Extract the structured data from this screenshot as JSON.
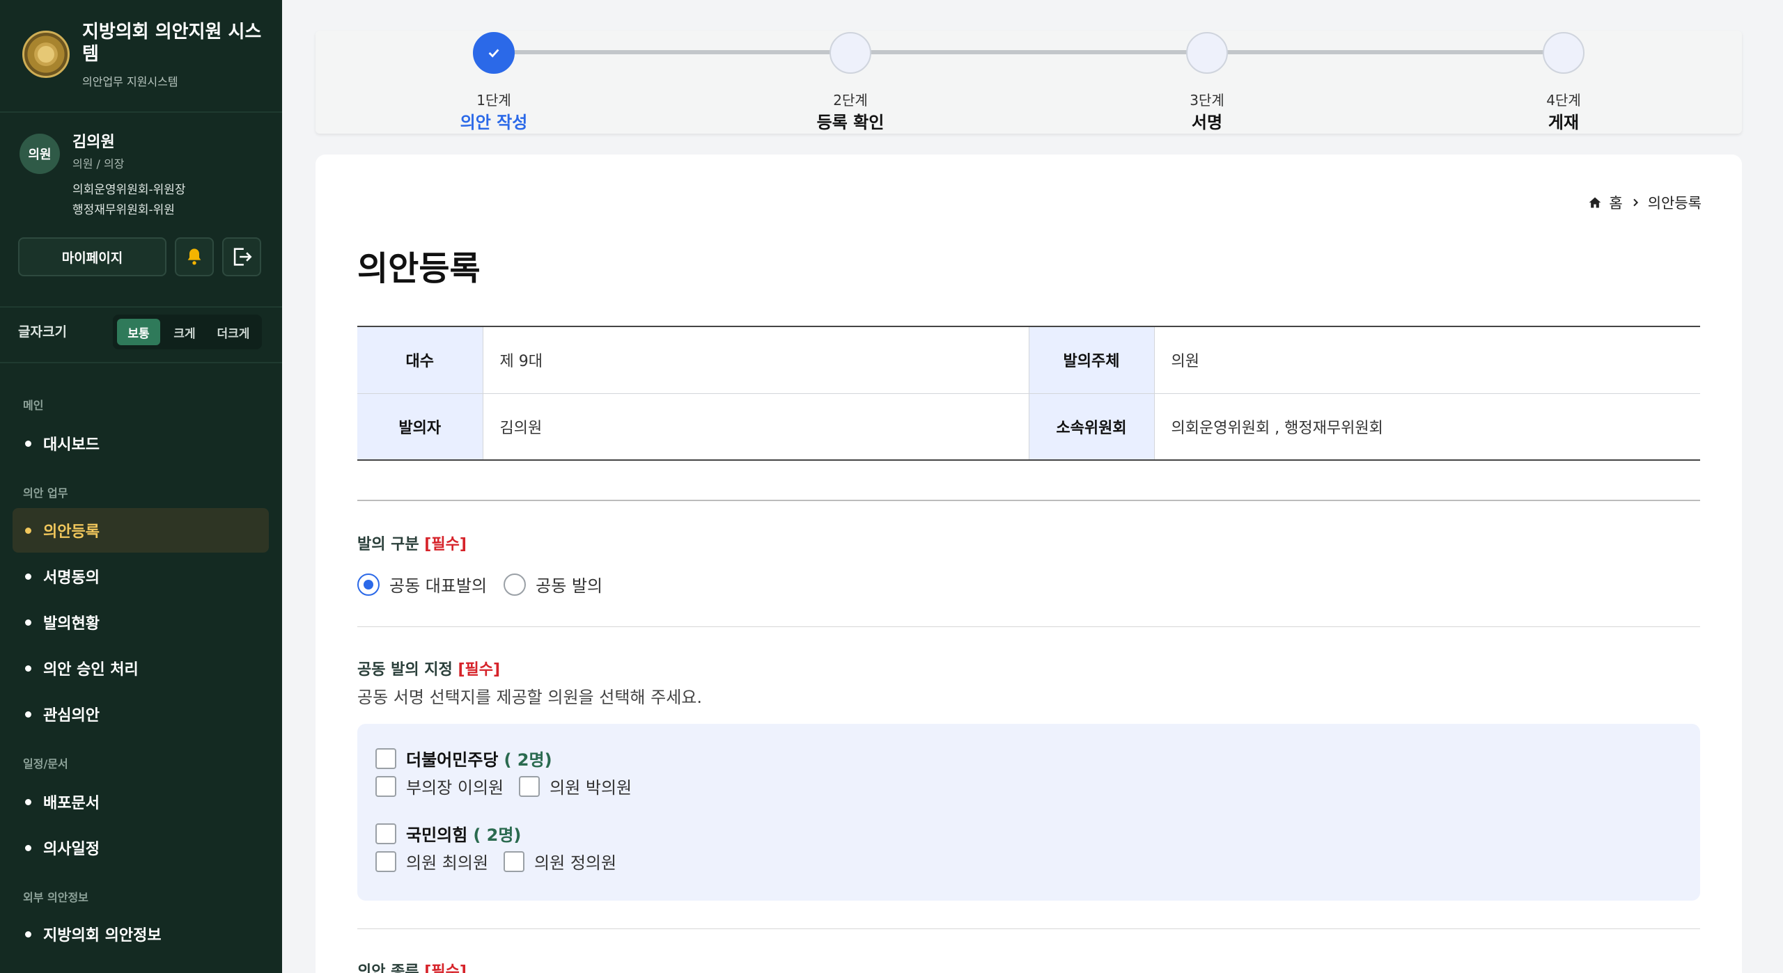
{
  "sidebar": {
    "brand": {
      "title": "지방의회 의안지원 시스템",
      "subtitle": "의안업무 지원시스템"
    },
    "profile": {
      "avatar": "의원",
      "name": "김의원",
      "role": "의원 / 의장",
      "committees": [
        "의회운영위원회-위원장",
        "행정재무위원회-위원"
      ]
    },
    "mypage": "마이페이지",
    "font_size": {
      "label": "글자크기",
      "options": [
        "보통",
        "크게",
        "더크게"
      ],
      "selected": "보통"
    },
    "sections": [
      {
        "title": "메인",
        "items": [
          "대시보드"
        ]
      },
      {
        "title": "의안 업무",
        "items": [
          "의안등록",
          "서명동의",
          "발의현황",
          "의안 승인 처리",
          "관심의안"
        ]
      },
      {
        "title": "일정/문서",
        "items": [
          "배포문서",
          "의사일정"
        ]
      },
      {
        "title": "외부 의안정보",
        "items": [
          "지방의회 의안정보"
        ]
      }
    ],
    "active_item": "의안등록"
  },
  "stepper": {
    "steps": [
      {
        "num": "1단계",
        "name": "의안 작성",
        "state": "done"
      },
      {
        "num": "2단계",
        "name": "등록 확인",
        "state": "pending"
      },
      {
        "num": "3단계",
        "name": "서명",
        "state": "pending"
      },
      {
        "num": "4단계",
        "name": "게재",
        "state": "pending"
      }
    ]
  },
  "breadcrumb": {
    "home": "홈",
    "current": "의안등록"
  },
  "page_title": "의안등록",
  "info": {
    "rows": [
      [
        {
          "th": "대수",
          "tv": "제 9대"
        },
        {
          "th": "발의주체",
          "tv": "의원"
        }
      ],
      [
        {
          "th": "발의자",
          "tv": "김의원"
        },
        {
          "th": "소속위원회",
          "tv": "의회운영위원회 , 행정재무위원회"
        }
      ]
    ]
  },
  "form": {
    "proposal_type": {
      "label": "발의 구분",
      "required": "[필수]",
      "options": [
        "공동 대표발의",
        "공동 발의"
      ],
      "selected": "공동 대표발의"
    },
    "cosign": {
      "label": "공동 발의 지정",
      "required": "[필수]",
      "description": "공동 서명 선택지를 제공할 의원을 선택해 주세요.",
      "parties": [
        {
          "name": "더불어민주당",
          "count": "( 2명)",
          "members": [
            "부의장 이의원",
            "의원 박의원"
          ]
        },
        {
          "name": "국민의힘",
          "count": "( 2명)",
          "members": [
            "의원 최의원",
            "의원 정의원"
          ]
        }
      ]
    },
    "bill_type": {
      "label": "의안 종류",
      "required": "[필수]"
    }
  },
  "colors": {
    "sidebar_bg": "#142a22",
    "accent_blue": "#2b69e8",
    "active_nav": "#f1c75c",
    "required_red": "#d6232a"
  }
}
